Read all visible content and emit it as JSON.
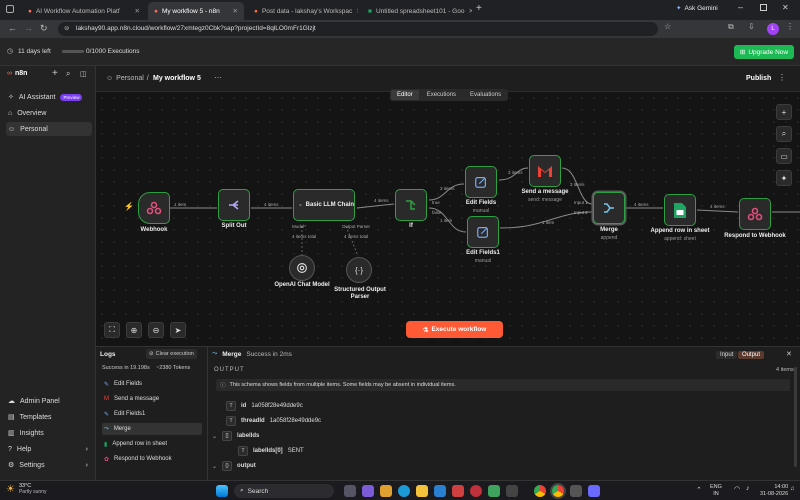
{
  "browser": {
    "tabs": [
      {
        "title": "AI Workflow Automation Platf",
        "active": false
      },
      {
        "title": "My workflow 5 - n8n",
        "active": true
      },
      {
        "title": "Post data - lakshay's Workspac",
        "active": false
      },
      {
        "title": "Untitled spreadsheet101 - Goo",
        "active": false
      }
    ],
    "ask_gemini": "Ask Gemini",
    "url": "lakshay90.app.n8n.cloud/workflow/27xmtegz0Cbk?sap?projectId=8qlLO0mFr1Glzjt",
    "profile_initial": "L"
  },
  "trial": {
    "days_left": "11 days left",
    "executions": "0/1000 Executions",
    "upgrade_label": "Upgrade Now"
  },
  "sidebar": {
    "brand": "n8n",
    "ai_assistant": "AI Assistant",
    "preview_badge": "Preview",
    "overview": "Overview",
    "personal": "Personal",
    "admin_panel": "Admin Panel",
    "templates": "Templates",
    "insights": "Insights",
    "help": "Help",
    "settings": "Settings"
  },
  "header": {
    "breadcrumb": "Personal",
    "separator": "/",
    "workflow_name": "My workflow 5",
    "more": "···",
    "publish": "Publish",
    "tabs": [
      "Editor",
      "Executions",
      "Evaluations"
    ]
  },
  "canvas": {
    "nodes": {
      "webhook": "Webhook",
      "split_out": "Split Out",
      "llm_chain": "Basic LLM Chain",
      "if": "If",
      "edit_fields": "Edit Fields",
      "edit_fields_sub": "manual",
      "edit_fields1": "Edit Fields1",
      "edit_fields1_sub": "manual",
      "send_message": "Send a message",
      "send_message_sub": "send: message",
      "merge": "Merge",
      "merge_sub": "append",
      "append_row": "Append row in sheet",
      "append_row_sub": "append: sheet",
      "respond": "Respond to Webhook",
      "openai": "OpenAI Chat Model",
      "parser_line1": "Structured Output",
      "parser_line2": "Parser"
    },
    "edges": {
      "webhook_split": "1 item",
      "split_llm": "4 items",
      "llm_if": "4 items",
      "if_true": "true",
      "if_false": "false",
      "if_edit": "3 items",
      "if_edit1": "1 item",
      "edit_send": "3 items",
      "send_merge": "3 items",
      "edit1_merge": "1 item",
      "merge_in1": "Input 1",
      "merge_in2": "Input 2",
      "merge_append": "4 items",
      "append_respond": "4 items",
      "model_port": "Model*",
      "parser_port": "Output Parser",
      "model_items": "4 items total",
      "parser_items": "4 items total"
    },
    "execute_label": "Execute workflow"
  },
  "logs": {
    "title": "Logs",
    "clear": "Clear execution",
    "success": "Success in 19.198s",
    "tokens": "~2380 Tokens",
    "items": [
      "Edit Fields",
      "Send a message",
      "Edit Fields1",
      "Merge",
      "Append row in sheet",
      "Respond to Webhook"
    ]
  },
  "output_panel": {
    "node_name": "Merge",
    "status": "Success in 2ms",
    "input_tab": "Input",
    "output_tab": "Output",
    "output_label": "OUTPUT",
    "item_count": "4 items",
    "schema_note": "This schema shows fields from multiple items. Some fields may be absent in individual items.",
    "fields": [
      {
        "key": "id",
        "value": "1a058f28e49dde9c",
        "type": "T"
      },
      {
        "key": "threadId",
        "value": "1a058f28e49dde9c",
        "type": "T"
      },
      {
        "key": "labelIds",
        "value": "",
        "type": "[]"
      },
      {
        "key": "labelIds[0]",
        "value": "SENT",
        "type": "T"
      },
      {
        "key": "output",
        "value": "",
        "type": "{}"
      }
    ]
  },
  "taskbar": {
    "temp": "33°C",
    "weather": "Partly sunny",
    "search": "Search",
    "lang1": "ENG",
    "lang2": "IN",
    "time": "14:00",
    "date": "31-08-2026"
  },
  "colors": {
    "accent": "#ff6d5a",
    "success": "#2ea043",
    "upgrade": "#1db954"
  }
}
